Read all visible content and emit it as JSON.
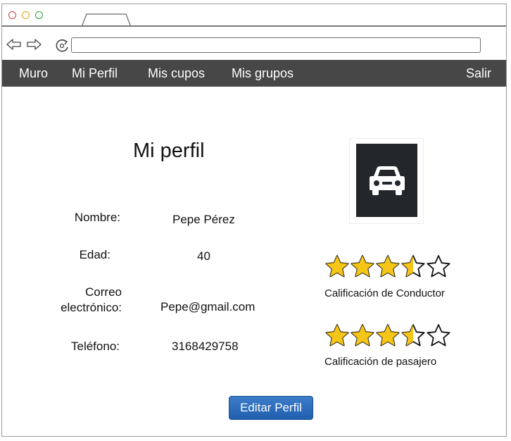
{
  "window": {
    "controls": [
      "close-dot",
      "minimize-dot",
      "maximize-dot"
    ],
    "control_colors": {
      "close": "#d13b3b",
      "minimize": "#e3a21a",
      "maximize": "#2e9e3a"
    }
  },
  "toolbar": {
    "back_icon": "arrow-left-icon",
    "forward_icon": "arrow-right-icon",
    "reload_icon": "reload-icon",
    "url_value": ""
  },
  "menu": {
    "items": [
      {
        "label": "Muro"
      },
      {
        "label": "Mi Perfil"
      },
      {
        "label": "Mis cupos"
      },
      {
        "label": "Mis grupos"
      }
    ],
    "logout_label": "Salir",
    "background": "#474747"
  },
  "profile": {
    "title": "Mi perfil",
    "fields": [
      {
        "label": "Nombre:",
        "value": "Pepe Pérez"
      },
      {
        "label": "Edad:",
        "value": "40"
      },
      {
        "label": "Correo electrónico:",
        "value": "Pepe@gmail.com"
      },
      {
        "label": "Teléfono:",
        "value": "3168429758"
      }
    ],
    "photo_icon": "car-icon"
  },
  "ratings": [
    {
      "caption": "Calificación de Conductor",
      "stars": 3.5,
      "max": 5
    },
    {
      "caption": "Calificación de pasajero",
      "stars": 3.5,
      "max": 5
    }
  ],
  "star_color": "#f5c518",
  "edit_button": {
    "label": "Editar Perfil"
  }
}
